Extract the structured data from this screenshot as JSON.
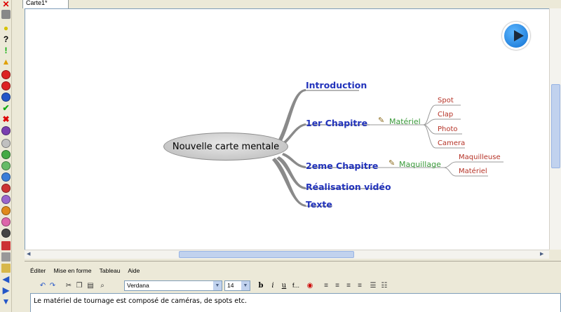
{
  "tab": {
    "title": "Carte1*"
  },
  "map": {
    "central": "Nouvelle carte mentale",
    "branches": [
      {
        "label": "Introduction"
      },
      {
        "label": "1er Chapitre",
        "attribute": "Matériel",
        "children": [
          "Spot",
          "Clap",
          "Photo",
          "Camera"
        ]
      },
      {
        "label": "2eme Chapitre",
        "attribute": "Maquillage",
        "children": [
          "Maquilleuse",
          "Matériel"
        ]
      },
      {
        "label": "Réalisation vidéo"
      },
      {
        "label": "Texte"
      }
    ]
  },
  "editor": {
    "menu": [
      "Éditer",
      "Mise en forme",
      "Tableau",
      "Aide"
    ],
    "font": "Verdana",
    "size": "14",
    "text": "Le matériel de tournage est composé de caméras, de spots etc."
  },
  "icons": [
    "close-icon",
    "trash-icon",
    "bulb-icon",
    "question-icon",
    "exclamation-icon",
    "warning-icon",
    "stop-icon",
    "minus-icon",
    "info-icon",
    "check-icon",
    "x-icon",
    "priority-icons"
  ]
}
